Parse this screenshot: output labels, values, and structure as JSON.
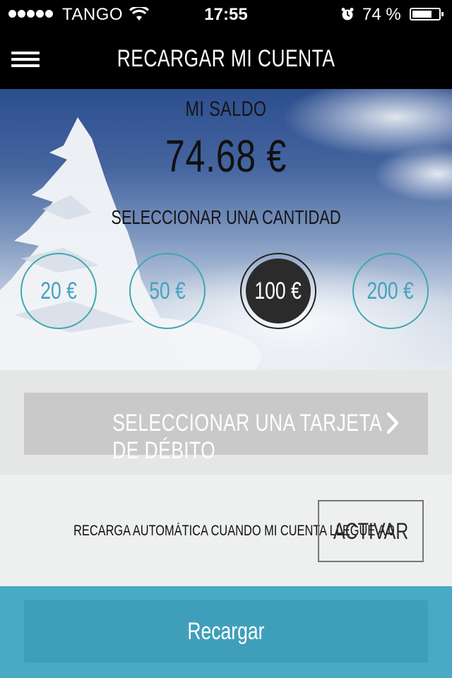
{
  "status_bar": {
    "carrier": "TANGO",
    "time": "17:55",
    "battery_percent": "74 %",
    "battery_level": 0.74
  },
  "header": {
    "title": "RECARGAR MI CUENTA"
  },
  "balance": {
    "label": "MI SALDO",
    "value": "74.68 €"
  },
  "amount_selector": {
    "label": "SELECCIONAR UNA CANTIDAD",
    "options": [
      "20 €",
      "50 €",
      "100 €",
      "200 €"
    ],
    "selected_index": 2
  },
  "debit_card": {
    "label": "SELECCIONAR UNA TARJETA DE DÉBITO"
  },
  "auto_reload": {
    "label": "RECARGA AUTOMÁTICA CUANDO MI CUENTA LLEGUE A 0",
    "button_label": "ACTIVAR"
  },
  "footer": {
    "recharge_label": "Recargar"
  },
  "colors": {
    "accent": "#46a2bd",
    "teal_border": "#3fa8ae",
    "bottom_bar": "#4aa9c4",
    "selected_circle": "#2b2b2b"
  }
}
